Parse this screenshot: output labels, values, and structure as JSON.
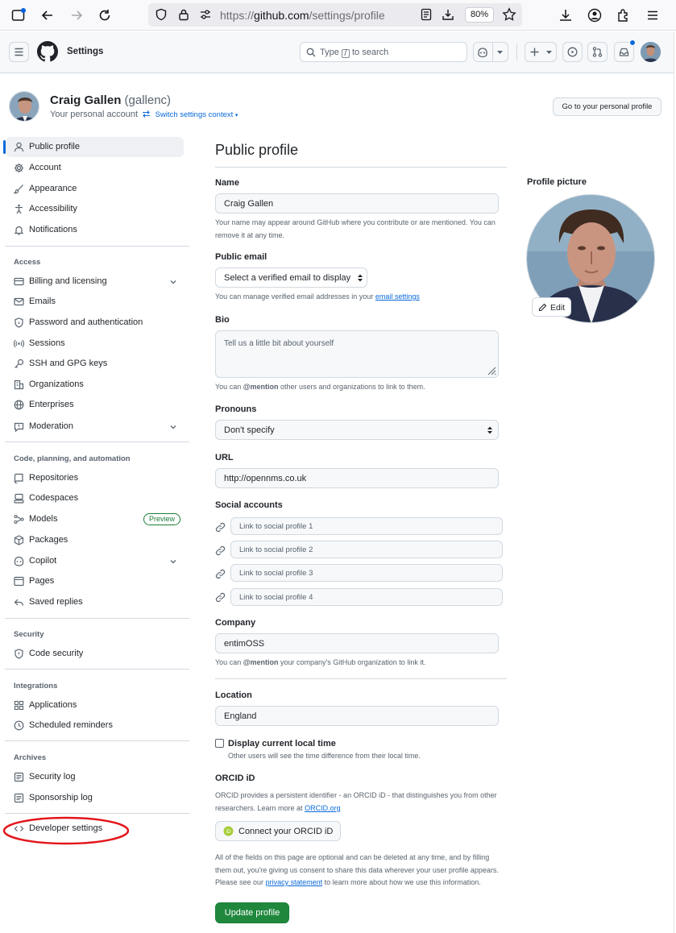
{
  "browser": {
    "url_prefix": "https://",
    "url_host": "github.com",
    "url_path": "/settings/profile",
    "zoom": "80%"
  },
  "header": {
    "title": "Settings",
    "search_placeholder_pre": "Type",
    "search_key": "/",
    "search_placeholder_post": "to search"
  },
  "account": {
    "name": "Craig Gallen",
    "handle": "(gallenc)",
    "context": "Your personal account",
    "switch_context": "Switch settings context",
    "go_profile": "Go to your personal profile"
  },
  "sidebar": {
    "top_items": [
      {
        "label": "Public profile",
        "icon": "person-icon"
      },
      {
        "label": "Account",
        "icon": "gear-icon"
      },
      {
        "label": "Appearance",
        "icon": "paintbrush-icon"
      },
      {
        "label": "Accessibility",
        "icon": "accessibility-icon"
      },
      {
        "label": "Notifications",
        "icon": "bell-icon"
      }
    ],
    "access_heading": "Access",
    "access_items": [
      {
        "label": "Billing and licensing",
        "icon": "credit-card-icon"
      },
      {
        "label": "Emails",
        "icon": "mail-icon"
      },
      {
        "label": "Password and authentication",
        "icon": "shield-lock-icon"
      },
      {
        "label": "Sessions",
        "icon": "broadcast-icon"
      },
      {
        "label": "SSH and GPG keys",
        "icon": "key-icon"
      },
      {
        "label": "Organizations",
        "icon": "organization-icon"
      },
      {
        "label": "Enterprises",
        "icon": "globe-icon"
      },
      {
        "label": "Moderation",
        "icon": "report-icon"
      }
    ],
    "code_heading": "Code, planning, and automation",
    "code_items": [
      {
        "label": "Repositories",
        "icon": "repo-icon"
      },
      {
        "label": "Codespaces",
        "icon": "codespaces-icon"
      },
      {
        "label": "Models",
        "icon": "models-icon"
      },
      {
        "label": "Packages",
        "icon": "package-icon"
      },
      {
        "label": "Copilot",
        "icon": "copilot-icon"
      },
      {
        "label": "Pages",
        "icon": "browser-icon"
      },
      {
        "label": "Saved replies",
        "icon": "reply-icon"
      }
    ],
    "preview_badge": "Preview",
    "security_heading": "Security",
    "security_items": [
      {
        "label": "Code security",
        "icon": "shield-icon"
      }
    ],
    "integrations_heading": "Integrations",
    "integrations_items": [
      {
        "label": "Applications",
        "icon": "apps-icon"
      },
      {
        "label": "Scheduled reminders",
        "icon": "clock-icon"
      }
    ],
    "archives_heading": "Archives",
    "archives_items": [
      {
        "label": "Security log",
        "icon": "log-icon"
      },
      {
        "label": "Sponsorship log",
        "icon": "log-icon"
      }
    ],
    "developer_settings": "Developer settings"
  },
  "main": {
    "heading": "Public profile",
    "name_label": "Name",
    "name_value": "Craig Gallen",
    "name_note": "Your name may appear around GitHub where you contribute or are mentioned. You can remove it at any time.",
    "email_label": "Public email",
    "email_select": "Select a verified email to display",
    "email_note_pre": "You can manage verified email addresses in your",
    "email_note_link": "email settings",
    "bio_label": "Bio",
    "bio_placeholder": "Tell us a little bit about yourself",
    "bio_note_pre": "You can",
    "bio_note_mention": "@mention",
    "bio_note_post": "other users and organizations to link to them.",
    "pronouns_label": "Pronouns",
    "pronouns_value": "Don't specify",
    "url_label": "URL",
    "url_value": "http://opennms.co.uk",
    "social_label": "Social accounts",
    "social_placeholders": [
      "Link to social profile 1",
      "Link to social profile 2",
      "Link to social profile 3",
      "Link to social profile 4"
    ],
    "company_label": "Company",
    "company_value": "entimOSS",
    "company_note_pre": "You can",
    "company_note_mention": "@mention",
    "company_note_post": "your company's GitHub organization to link it.",
    "location_label": "Location",
    "location_value": "England",
    "localtime_label": "Display current local time",
    "localtime_note": "Other users will see the time difference from their local time.",
    "orcid_label": "ORCID iD",
    "orcid_note_pre": "ORCID provides a persistent identifier - an ORCID iD - that distinguishes you from other researchers. Learn more at",
    "orcid_note_link": "ORCID.org",
    "orcid_button": "Connect your ORCID iD",
    "privacy_note_pre": "All of the fields on this page are optional and can be deleted at any time, and by filling them out, you're giving us consent to share this data wherever your user profile appears. Please see our",
    "privacy_note_link": "privacy statement",
    "privacy_note_post": "to learn more about how we use this information.",
    "update_button": "Update profile",
    "picture_label": "Profile picture",
    "edit_button": "Edit"
  },
  "colors": {
    "accent": "#0969da",
    "primary_button": "#1f883d",
    "annotation": "#e3151a"
  }
}
